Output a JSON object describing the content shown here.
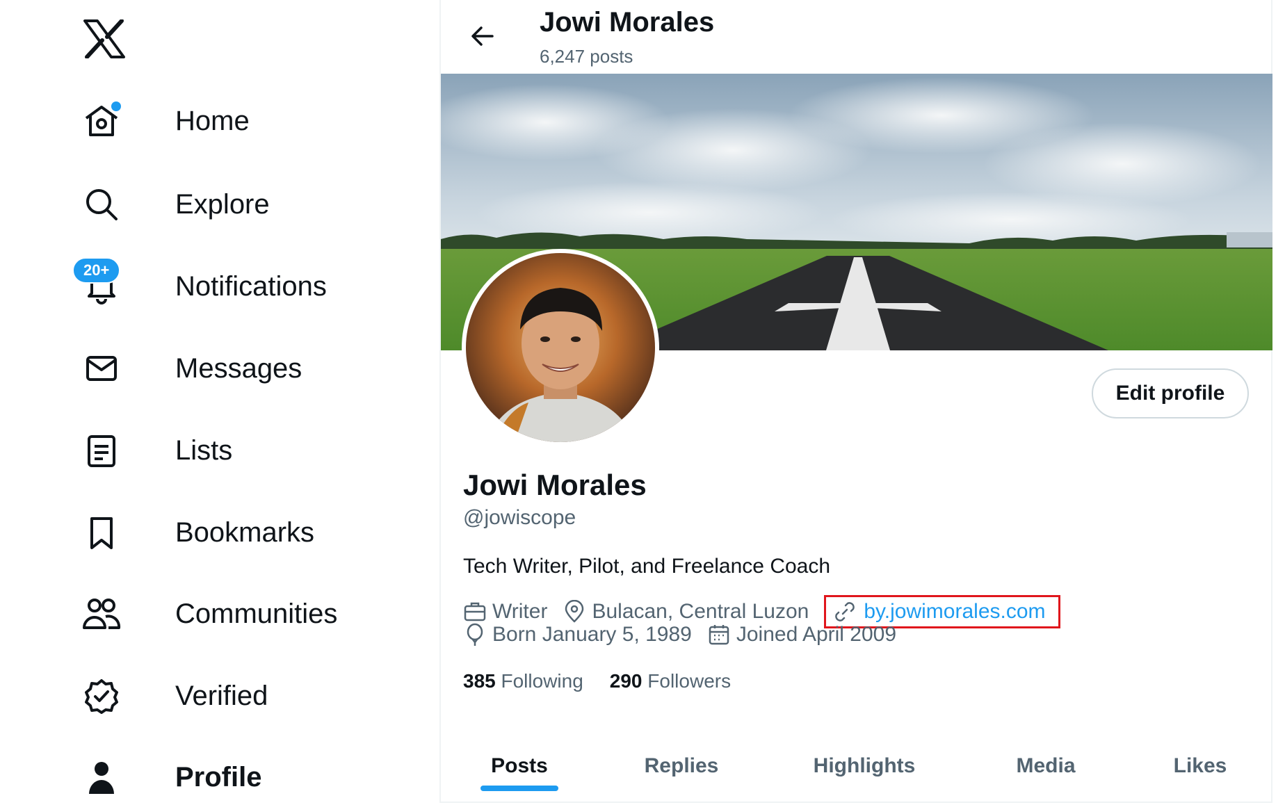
{
  "sidebar": {
    "logo": "x-logo-icon",
    "items": [
      {
        "label": "Home",
        "icon": "home-icon",
        "has_dot": true
      },
      {
        "label": "Explore",
        "icon": "search-icon"
      },
      {
        "label": "Notifications",
        "icon": "bell-icon",
        "badge": "20+"
      },
      {
        "label": "Messages",
        "icon": "envelope-icon"
      },
      {
        "label": "Lists",
        "icon": "list-icon"
      },
      {
        "label": "Bookmarks",
        "icon": "bookmark-icon"
      },
      {
        "label": "Communities",
        "icon": "people-icon"
      },
      {
        "label": "Verified",
        "icon": "verified-badge-icon"
      },
      {
        "label": "Profile",
        "icon": "person-icon",
        "active": true
      }
    ]
  },
  "header": {
    "name": "Jowi Morales",
    "posts": "6,247 posts"
  },
  "profile": {
    "edit_button": "Edit profile",
    "name": "Jowi Morales",
    "handle": "@jowiscope",
    "bio": "Tech Writer, Pilot, and Freelance Coach",
    "occupation": "Writer",
    "location": "Bulacan, Central Luzon",
    "website": "by.jowimorales.com",
    "birthday": "Born January 5, 1989",
    "joined": "Joined April 2009",
    "following_count": "385",
    "following_label": "Following",
    "followers_count": "290",
    "followers_label": "Followers"
  },
  "tabs": [
    {
      "label": "Posts",
      "active": true
    },
    {
      "label": "Replies"
    },
    {
      "label": "Highlights"
    },
    {
      "label": "Media"
    },
    {
      "label": "Likes"
    }
  ],
  "colors": {
    "accent": "#1d9bf0",
    "highlight_box": "#e0161c",
    "text_primary": "#0f1419",
    "text_secondary": "#536471"
  }
}
